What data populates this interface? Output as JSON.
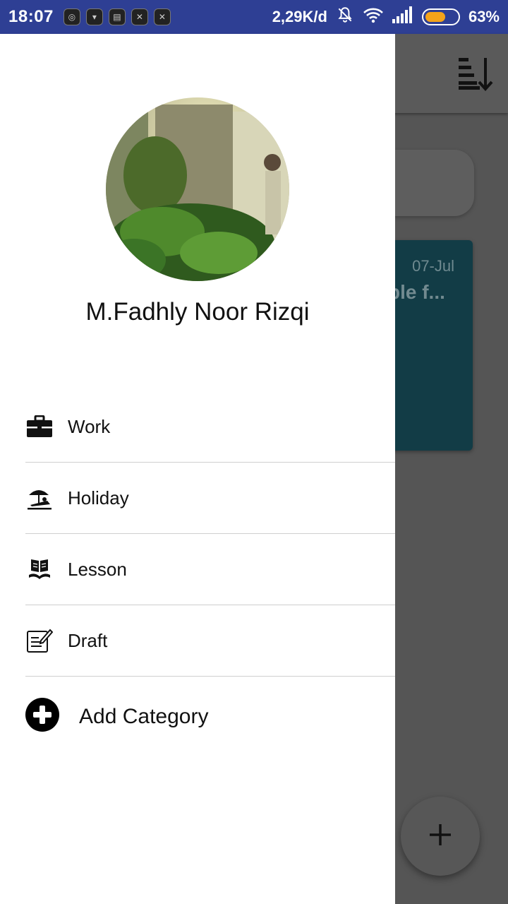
{
  "status_bar": {
    "time": "18:07",
    "network_speed": "2,29K/d",
    "battery_percent": "63%",
    "battery_level": 0.63,
    "icons": [
      "mute-icon",
      "wifi-icon",
      "signal-icon",
      "battery-icon"
    ],
    "app_notifications": [
      "app-icon-1",
      "app-icon-2",
      "app-icon-3",
      "app-icon-4",
      "app-icon-5"
    ]
  },
  "drawer": {
    "user_name": "M.Fadhly Noor Rizqi",
    "menu_items": [
      {
        "label": "Work",
        "icon": "briefcase-icon"
      },
      {
        "label": "Holiday",
        "icon": "beach-umbrella-icon"
      },
      {
        "label": "Lesson",
        "icon": "book-icon"
      },
      {
        "label": "Draft",
        "icon": "draft-edit-icon"
      }
    ],
    "add_category_label": "Add Category"
  },
  "background": {
    "card_date": "07-Jul",
    "card_title_fragment": "ple f..."
  },
  "colors": {
    "status_bar": "#2e3f94",
    "scrim": "#555555",
    "card": "#123c46",
    "battery_fill": "#f5a31a"
  }
}
